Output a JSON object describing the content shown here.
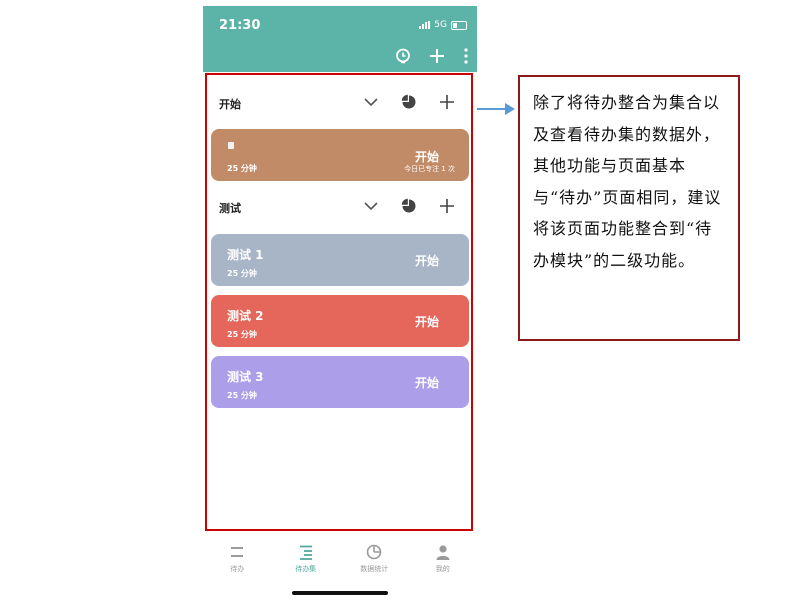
{
  "status": {
    "time": "21:30",
    "network": "5G"
  },
  "header": {
    "icons": [
      "clock-icon",
      "plus-icon",
      "more-vertical-icon"
    ]
  },
  "groups": [
    {
      "title": "开始",
      "tasks": [
        {
          "name": "",
          "duration": "25 分钟",
          "start_label": "开始",
          "extra": "今日已专注 1 次",
          "color": "#c28b67"
        }
      ]
    },
    {
      "title": "测试",
      "tasks": [
        {
          "name": "测试 1",
          "duration": "25 分钟",
          "start_label": "开始",
          "color": "#a7b5c6"
        },
        {
          "name": "测试 2",
          "duration": "25 分钟",
          "start_label": "开始",
          "color": "#e5665a"
        },
        {
          "name": "测试 3",
          "duration": "25 分钟",
          "start_label": "开始",
          "color": "#ac9ee8"
        }
      ]
    }
  ],
  "bottom_nav": [
    {
      "label": "待办",
      "icon": "list-icon",
      "active": false
    },
    {
      "label": "待办集",
      "icon": "todo-set-icon",
      "active": true
    },
    {
      "label": "数据统计",
      "icon": "pie-chart-icon",
      "active": false
    },
    {
      "label": "我的",
      "icon": "person-icon",
      "active": false
    }
  ],
  "annotation": {
    "text": "除了将待办整合为集合以及查看待办集的数据外，其他功能与页面基本与“待办”页面相同，建议将该页面功能整合到“待办模块”的二级功能。"
  },
  "colors": {
    "header": "#5cb3a8",
    "accent": "#4ca99c",
    "highlight_frame": "#cc0000",
    "annotation_border": "#8b1a1a",
    "arrow": "#5b9bd5"
  }
}
